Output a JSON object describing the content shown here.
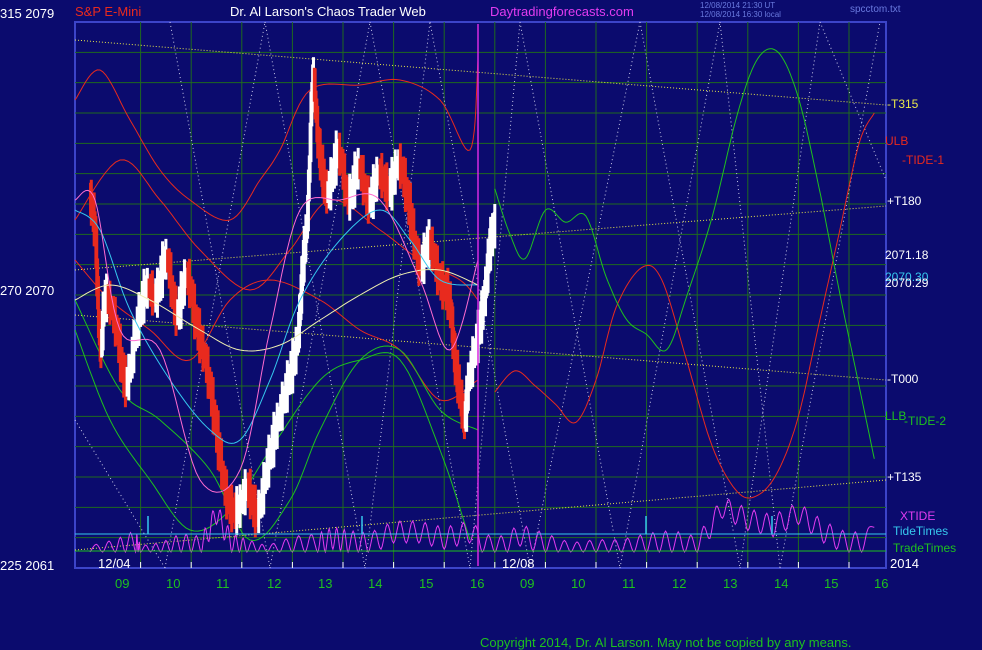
{
  "header": {
    "instrument": "S&P E-Mini",
    "site_title": "Dr. Al Larson's Chaos Trader Web",
    "site_url": "Daytradingforecasts.com",
    "timestamp_1": "12/08/2014 21:30 UT",
    "timestamp_2": "12/08/2014 16:30 local",
    "filename": "spcctom.txt"
  },
  "y_labels": {
    "top": "315  2079",
    "mid": "270  2070",
    "bottom": "225  2061"
  },
  "right_labels": {
    "t315": "-T315",
    "ulb": "ULB",
    "tide1": "-TIDE-1",
    "t180": "+T180",
    "price1": "2071.18",
    "price2": "2070.30",
    "price3": "2070.29",
    "t000": "-T000",
    "llb": "LLB",
    "tide2": "-TIDE-2",
    "t135": "+T135",
    "xtide": "XTIDE",
    "tidetimes": "TideTimes",
    "tradetimes": "TradeTimes",
    "year": "2014"
  },
  "copyright": "Copyright 2014, Dr. Al Larson. May not be copied by any means.",
  "colors": {
    "background": "#0b0b6e",
    "grid": "#1f6a1f",
    "frame": "#3c44c8",
    "red": "#e82a1e",
    "green": "#1ec21e",
    "yellow": "#e8e84a",
    "cyan": "#36c8ee",
    "magenta": "#e23cf0",
    "white": "#ffffff",
    "today_divider": "#d82ae0"
  },
  "chart_data": {
    "type": "line",
    "title": "S&P E-Mini",
    "y_price_range": [
      2061,
      2079
    ],
    "y_degree_range": [
      225,
      315
    ],
    "date_markers": [
      "12/04",
      "12/08"
    ],
    "x_tick_labels_day1": [
      "09",
      "10",
      "11",
      "12",
      "13",
      "14",
      "15",
      "16"
    ],
    "x_tick_labels_day2": [
      "09",
      "10",
      "11",
      "12",
      "13",
      "14",
      "15",
      "16"
    ],
    "levels": {
      "last": 2071.18,
      "a": 2070.3,
      "b": 2070.29
    },
    "series": [
      {
        "name": "TIDE-1",
        "color": "red"
      },
      {
        "name": "TIDE-2",
        "color": "green"
      },
      {
        "name": "ULB",
        "color": "red"
      },
      {
        "name": "LLB",
        "color": "green"
      },
      {
        "name": "XTIDE",
        "color": "magenta"
      },
      {
        "name": "TideTimes",
        "color": "cyan"
      },
      {
        "name": "TradeTimes",
        "color": "green"
      }
    ],
    "price_path": [
      [
        8.0,
        2073.2
      ],
      [
        8.1,
        2072.0
      ],
      [
        8.2,
        2068.3
      ],
      [
        8.3,
        2069.9
      ],
      [
        8.5,
        2069.0
      ],
      [
        8.7,
        2067.1
      ],
      [
        8.9,
        2068.8
      ],
      [
        9.1,
        2070.2
      ],
      [
        9.3,
        2070.0
      ],
      [
        9.5,
        2071.2
      ],
      [
        9.7,
        2069.4
      ],
      [
        9.9,
        2070.6
      ],
      [
        10.1,
        2069.0
      ],
      [
        10.3,
        2067.6
      ],
      [
        10.5,
        2065.4
      ],
      [
        10.7,
        2063.3
      ],
      [
        10.9,
        2062.9
      ],
      [
        11.1,
        2063.6
      ],
      [
        11.3,
        2062.8
      ],
      [
        11.5,
        2064.4
      ],
      [
        11.7,
        2065.8
      ],
      [
        11.9,
        2067.1
      ],
      [
        12.1,
        2068.6
      ],
      [
        12.2,
        2070.9
      ],
      [
        12.3,
        2072.8
      ],
      [
        12.4,
        2077.0
      ],
      [
        12.5,
        2075.2
      ],
      [
        12.6,
        2074.0
      ],
      [
        12.7,
        2073.4
      ],
      [
        12.9,
        2074.7
      ],
      [
        13.1,
        2073.2
      ],
      [
        13.3,
        2074.2
      ],
      [
        13.5,
        2073.1
      ],
      [
        13.7,
        2074.0
      ],
      [
        13.9,
        2073.5
      ],
      [
        14.1,
        2074.3
      ],
      [
        14.3,
        2072.9
      ],
      [
        14.5,
        2071.0
      ],
      [
        14.7,
        2071.7
      ],
      [
        14.9,
        2070.5
      ],
      [
        15.1,
        2069.8
      ],
      [
        15.2,
        2068.0
      ],
      [
        15.3,
        2066.9
      ],
      [
        15.4,
        2066.0
      ],
      [
        15.5,
        2067.4
      ],
      [
        15.7,
        2069.0
      ],
      [
        15.8,
        2070.0
      ],
      [
        15.9,
        2071.6
      ],
      [
        16.0,
        2072.3
      ]
    ],
    "xtide": [
      [
        8.0,
        0.1
      ],
      [
        8.5,
        0.2
      ],
      [
        8.9,
        0.35
      ],
      [
        9.0,
        0.1
      ],
      [
        9.4,
        0.15
      ],
      [
        9.8,
        0.3
      ],
      [
        10.2,
        0.25
      ],
      [
        10.5,
        0.8
      ],
      [
        10.8,
        0.3
      ],
      [
        11.1,
        0.2
      ],
      [
        11.5,
        0.1
      ],
      [
        12.0,
        0.25
      ],
      [
        12.5,
        0.3
      ],
      [
        12.8,
        0.4
      ],
      [
        13.1,
        0.35
      ],
      [
        13.5,
        0.3
      ],
      [
        14.0,
        0.5
      ],
      [
        14.5,
        0.5
      ],
      [
        15.0,
        0.4
      ],
      [
        15.5,
        0.5
      ],
      [
        16.0,
        0.2
      ],
      [
        16.5,
        0.45
      ],
      [
        17.0,
        0.3
      ],
      [
        17.5,
        0.15
      ],
      [
        18.0,
        0.2
      ],
      [
        18.5,
        0.2
      ],
      [
        19.0,
        0.3
      ],
      [
        19.5,
        0.35
      ],
      [
        20.0,
        0.25
      ],
      [
        20.5,
        0.9
      ],
      [
        21.0,
        0.7
      ],
      [
        21.5,
        0.6
      ],
      [
        22.0,
        0.8
      ],
      [
        22.5,
        0.5
      ],
      [
        23.0,
        0.3
      ],
      [
        23.5,
        0.4
      ]
    ],
    "tide1_future": [
      [
        16.0,
        2066.8
      ],
      [
        16.4,
        2067.5
      ],
      [
        16.8,
        2067.0
      ],
      [
        17.2,
        2066.4
      ],
      [
        17.6,
        2065.8
      ],
      [
        18.0,
        2067.2
      ],
      [
        18.4,
        2069.6
      ],
      [
        18.9,
        2070.9
      ],
      [
        19.3,
        2070.5
      ],
      [
        19.8,
        2067.8
      ],
      [
        20.3,
        2065.0
      ],
      [
        20.8,
        2063.5
      ],
      [
        21.2,
        2063.4
      ],
      [
        21.6,
        2064.2
      ],
      [
        22.0,
        2066.0
      ],
      [
        22.4,
        2069.0
      ],
      [
        22.8,
        2072.0
      ],
      [
        23.2,
        2075.0
      ],
      [
        23.5,
        2076.0
      ]
    ],
    "tide2_future": [
      [
        16.0,
        2073.5
      ],
      [
        16.3,
        2072.0
      ],
      [
        16.6,
        2071.2
      ],
      [
        17.0,
        2072.8
      ],
      [
        17.4,
        2072.4
      ],
      [
        17.8,
        2072.6
      ],
      [
        18.2,
        2070.6
      ],
      [
        18.6,
        2069.2
      ],
      [
        19.0,
        2068.7
      ],
      [
        19.4,
        2068.2
      ],
      [
        19.8,
        2070.0
      ],
      [
        20.3,
        2072.6
      ],
      [
        20.8,
        2076.0
      ],
      [
        21.2,
        2077.8
      ],
      [
        21.6,
        2078.0
      ],
      [
        22.0,
        2076.5
      ],
      [
        22.4,
        2073.6
      ],
      [
        22.8,
        2070.2
      ],
      [
        23.2,
        2067.0
      ],
      [
        23.5,
        2064.6
      ]
    ]
  }
}
